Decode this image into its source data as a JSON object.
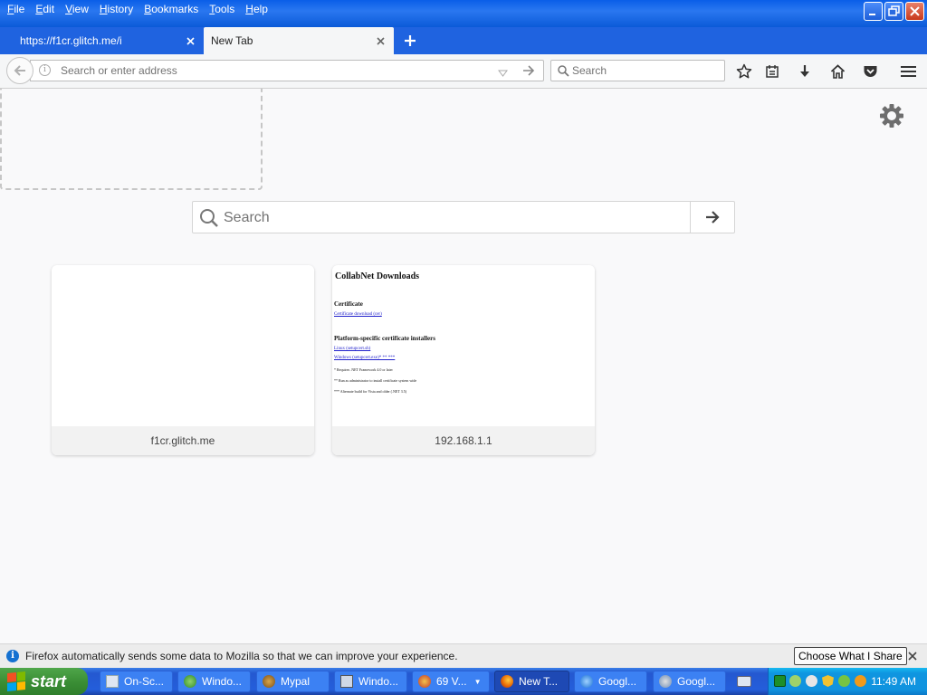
{
  "menu": [
    {
      "label": "File",
      "accel": "F",
      "rest": "ile"
    },
    {
      "label": "Edit",
      "accel": "E",
      "rest": "dit"
    },
    {
      "label": "View",
      "accel": "V",
      "rest": "iew"
    },
    {
      "label": "History",
      "accel": "H",
      "rest": "istory"
    },
    {
      "label": "Bookmarks",
      "accel": "B",
      "rest": "ookmarks"
    },
    {
      "label": "Tools",
      "accel": "T",
      "rest": "ools"
    },
    {
      "label": "Help",
      "accel": "H",
      "rest": "elp"
    }
  ],
  "tabs": [
    {
      "label": "https://f1cr.glitch.me/i"
    },
    {
      "label": "New Tab"
    }
  ],
  "navbar": {
    "url_placeholder": "Search or enter address",
    "search_placeholder": "Search"
  },
  "content": {
    "search_placeholder": "Search"
  },
  "tiles": [
    {
      "caption": "f1cr.glitch.me"
    },
    {
      "caption": "192.168.1.1",
      "thumb": {
        "title": "CollabNet Downloads",
        "heading1": "Certificate",
        "link1": "Certificate download (cer)",
        "heading2": "Platform-specific certificate installers",
        "link2": "Linux (setupcert.sh)",
        "link3": "Windows (setupcert.exe)* ** ***",
        "note1": "* Requires .NET Framework 4.0 or later",
        "note2": "** Run as administrator to install certificate system wide",
        "note3": "*** Alternate build for Vista and older (.NET 3.5)"
      }
    }
  ],
  "notification": {
    "message": "Firefox automatically sends some data to Mozilla so that we can improve your experience.",
    "button": "Choose What I Share"
  },
  "taskbar": {
    "start": "start",
    "tasks": [
      "On-Sc...",
      "Windo...",
      "Mypal",
      "Windo...",
      "69 V...",
      "New T...",
      "Googl...",
      "Googl..."
    ],
    "clock": "11:49 AM"
  },
  "colors": {
    "titlebar": "#0a5ee8",
    "start_green": "#3b8f36",
    "tray_blue": "#0f95e0"
  }
}
